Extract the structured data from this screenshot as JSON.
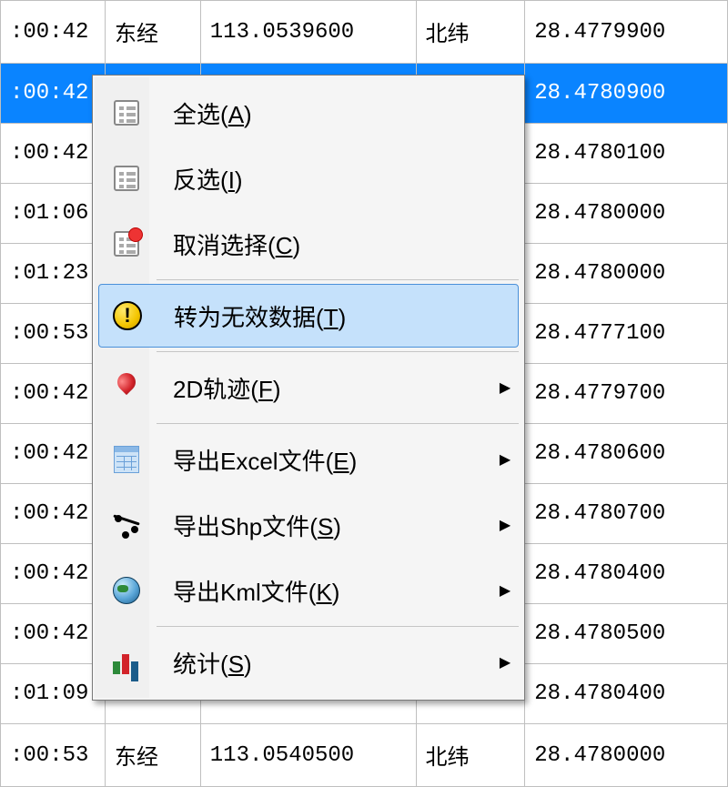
{
  "rows": [
    {
      "time": ":00:42",
      "lon_label": "东经",
      "lon": "113.0539600",
      "lat_label": "北纬",
      "lat": "28.4779900",
      "selected": false
    },
    {
      "time": ":00:42",
      "lon_label": "",
      "lon": "",
      "lat_label": "",
      "lat": "28.4780900",
      "selected": true
    },
    {
      "time": ":00:42",
      "lon_label": "",
      "lon": "",
      "lat_label": "",
      "lat": "28.4780100",
      "selected": false
    },
    {
      "time": ":01:06",
      "lon_label": "",
      "lon": "",
      "lat_label": "",
      "lat": "28.4780000",
      "selected": false
    },
    {
      "time": ":01:23",
      "lon_label": "",
      "lon": "",
      "lat_label": "",
      "lat": "28.4780000",
      "selected": false
    },
    {
      "time": ":00:53",
      "lon_label": "",
      "lon": "",
      "lat_label": "",
      "lat": "28.4777100",
      "selected": false
    },
    {
      "time": ":00:42",
      "lon_label": "",
      "lon": "",
      "lat_label": "",
      "lat": "28.4779700",
      "selected": false
    },
    {
      "time": ":00:42",
      "lon_label": "",
      "lon": "",
      "lat_label": "",
      "lat": "28.4780600",
      "selected": false
    },
    {
      "time": ":00:42",
      "lon_label": "",
      "lon": "",
      "lat_label": "",
      "lat": "28.4780700",
      "selected": false
    },
    {
      "time": ":00:42",
      "lon_label": "",
      "lon": "",
      "lat_label": "",
      "lat": "28.4780400",
      "selected": false
    },
    {
      "time": ":00:42",
      "lon_label": "",
      "lon": "",
      "lat_label": "",
      "lat": "28.4780500",
      "selected": false
    },
    {
      "time": ":01:09",
      "lon_label": "",
      "lon": "",
      "lat_label": "",
      "lat": "28.4780400",
      "selected": false
    },
    {
      "time": ":00:53",
      "lon_label": "东经",
      "lon": "113.0540500",
      "lat_label": "北纬",
      "lat": "28.4780000",
      "selected": false
    }
  ],
  "menu": {
    "select_all": "全选",
    "select_all_key": "A",
    "invert": "反选",
    "invert_key": "I",
    "cancel": "取消选择",
    "cancel_key": "C",
    "to_invalid": "转为无效数据",
    "to_invalid_key": "T",
    "track2d": "2D轨迹",
    "track2d_key": "F",
    "export_excel": "导出Excel文件",
    "export_excel_key": "E",
    "export_shp": "导出Shp文件",
    "export_shp_key": "S",
    "export_kml": "导出Kml文件",
    "export_kml_key": "K",
    "stats": "统计",
    "stats_key": "S"
  }
}
